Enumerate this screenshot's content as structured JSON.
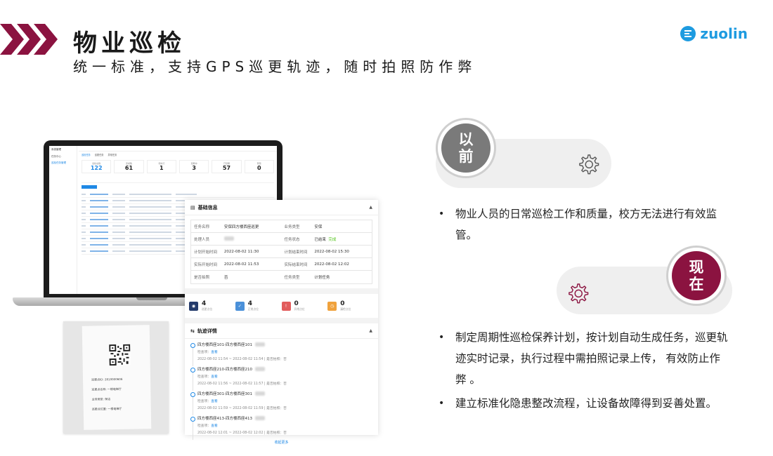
{
  "header": {
    "title": "物业巡检",
    "subtitle": "统一标准，支持GPS巡更轨迹，随时拍照防作弊",
    "brand": "zuolin"
  },
  "laptop": {
    "sidebar_items": [
      "系统管理",
      "任务中心",
      "巡检任务管理"
    ],
    "tabs": [
      "巡检任务",
      "巡更任务",
      "异常任务"
    ],
    "stats": [
      {
        "label": "巡检总数",
        "value": "122"
      },
      {
        "label": "完成数",
        "value": "61"
      },
      {
        "label": "待执行",
        "value": "1"
      },
      {
        "label": "延期中",
        "value": "3"
      },
      {
        "label": "已延期",
        "value": "57"
      },
      {
        "label": "预警",
        "value": "0"
      }
    ]
  },
  "receipt": {
    "lines": [
      "巡更点ID: 2810000606",
      "巡更点名称: 一楼电梯厅",
      "业务类型: 保洁",
      "巡更点位置: 一楼电梯厅"
    ]
  },
  "detail": {
    "basic_title": "基础信息",
    "rows": [
      {
        "k1": "任务名称",
        "v1": "安保四方楼西座巡更",
        "k2": "业务类型",
        "v2": "安保"
      },
      {
        "k1": "处理人员",
        "v1": "",
        "k2": "任务状态",
        "v2": "已结束",
        "v2b": "完成"
      },
      {
        "k1": "计划开始时间",
        "v1": "2022-08-02 11:30",
        "k2": "计划结束时间",
        "v2": "2022-08-02 15:30"
      },
      {
        "k1": "实际开始时间",
        "v1": "2022-08-02 11:53",
        "k2": "实际结束时间",
        "v2": "2022-08-02 12:02"
      },
      {
        "k1": "是否拍照",
        "v1": "否",
        "k2": "任务类型",
        "v2": "计划任务"
      }
    ],
    "counters": [
      {
        "num": "4",
        "label": "巡更点位",
        "color": "#243b6b"
      },
      {
        "num": "4",
        "label": "正常点位",
        "color": "#4a90d9"
      },
      {
        "num": "0",
        "label": "异常点位",
        "color": "#e25c5c"
      },
      {
        "num": "0",
        "label": "漏检点位",
        "color": "#f0a23c"
      }
    ],
    "track_title": "轨迹详情",
    "track": [
      {
        "name": "四方楼西座101-四方楼西座101",
        "check_label": "检查项：",
        "check_link": "查看",
        "time": "2022-08-02 11:54 ~ 2022-08-02 11:54 | 是否拍照：否"
      },
      {
        "name": "四方楼西座210-四方楼西座210",
        "check_label": "检查项：",
        "check_link": "查看",
        "time": "2022-08-02 11:56 ~ 2022-08-02 11:57 | 是否拍照：否"
      },
      {
        "name": "四方楼西座301-四方楼西座301",
        "check_label": "检查项：",
        "check_link": "查看",
        "time": "2022-08-02 11:59 ~ 2022-08-02 11:59 | 是否拍照：否"
      },
      {
        "name": "四方楼西座413-四方楼西座413",
        "check_label": "检查项：",
        "check_link": "查看",
        "time": "2022-08-02 12:01 ~ 2022-08-02 12:02 | 是否拍照：否"
      }
    ],
    "more": "收起更多"
  },
  "before": {
    "circle_line1": "以",
    "circle_line2": "前",
    "color": "#7a7a7a",
    "bullets": [
      "物业人员的日常巡检工作和质量，校方无法进行有效监管。"
    ]
  },
  "after": {
    "circle_line1": "现",
    "circle_line2": "在",
    "color": "#8b1340",
    "bullets": [
      "制定周期性巡检保养计划，按计划自动生成任务，巡更轨迹实时记录，执行过程中需拍照记录上传， 有效防止作弊 。",
      "建立标准化隐患整改流程，让设备故障得到妥善处置。"
    ]
  }
}
